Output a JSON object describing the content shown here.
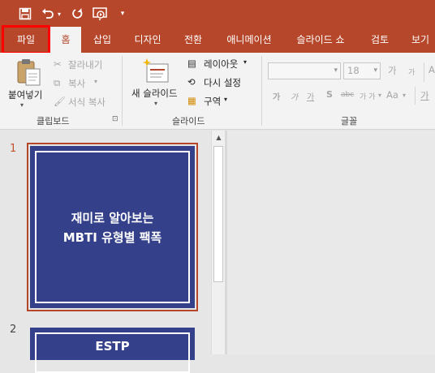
{
  "quick_access": {
    "save_icon": "save-icon",
    "undo_icon": "undo-icon",
    "redo_icon": "redo-icon",
    "slideshow_icon": "present-from-start-icon",
    "customize_icon": "customize-qat-icon"
  },
  "tabs": [
    {
      "label": "파일"
    },
    {
      "label": "홈"
    },
    {
      "label": "삽입"
    },
    {
      "label": "디자인"
    },
    {
      "label": "전환"
    },
    {
      "label": "애니메이션"
    },
    {
      "label": "슬라이드 쇼"
    },
    {
      "label": "검토"
    },
    {
      "label": "보기"
    }
  ],
  "ribbon": {
    "clipboard": {
      "paste": "붙여넣기",
      "cut": "잘라내기",
      "copy": "복사",
      "format_painter": "서식 복사",
      "group_label": "클립보드"
    },
    "slides": {
      "new_slide": "새 슬라이드",
      "layout": "레이아웃",
      "reset": "다시 설정",
      "section": "구역",
      "group_label": "슬라이드"
    },
    "font": {
      "size": "18",
      "grow": "가",
      "shrink": "가",
      "bold": "가",
      "italic": "가",
      "underline": "가",
      "shadow": "S",
      "strike": "abc",
      "spacing": "가 가",
      "change_case": "Aa",
      "highlight": "가",
      "group_label": "글꼴"
    }
  },
  "slides": [
    {
      "number": "1",
      "title_line1": "재미로 알아보는",
      "title_line2": "MBTI 유형별 팩폭"
    },
    {
      "number": "2",
      "title_line1": "ESTP"
    }
  ],
  "colors": {
    "accent": "#b7472a",
    "slide_bg": "#34408a",
    "highlight_box": "#ff0000"
  }
}
